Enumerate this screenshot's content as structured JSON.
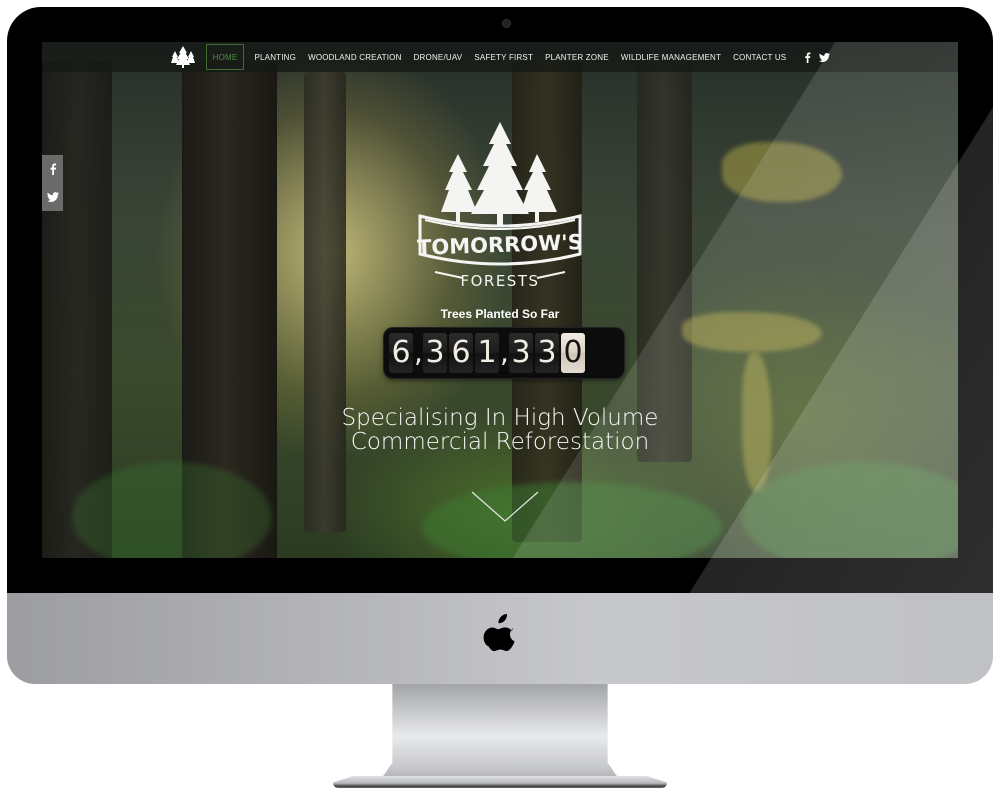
{
  "nav": {
    "items": [
      {
        "label": "HOME",
        "active": true
      },
      {
        "label": "PLANTING",
        "active": false
      },
      {
        "label": "WOODLAND CREATION",
        "active": false
      },
      {
        "label": "DRONE/UAV",
        "active": false
      },
      {
        "label": "SAFETY FIRST",
        "active": false
      },
      {
        "label": "PLANTER ZONE",
        "active": false
      },
      {
        "label": "WILDLIFE MANAGEMENT",
        "active": false
      },
      {
        "label": "CONTACT US",
        "active": false
      }
    ],
    "social": [
      "facebook-icon",
      "twitter-icon"
    ],
    "active_color": "#4e8a3f"
  },
  "side_social": [
    "facebook-icon",
    "twitter-icon"
  ],
  "logo": {
    "line1": "TOMORROW'S",
    "line2": "FORESTS"
  },
  "counter": {
    "label": "Trees Planted So Far",
    "value": "6,361,330",
    "digits": [
      "6",
      ",",
      "3",
      "6",
      "1",
      ",",
      "3",
      "3",
      "0"
    ]
  },
  "hero": {
    "tagline_line1": "Specialising In High Volume",
    "tagline_line2": "Commercial Reforestation"
  },
  "device": {
    "type": "iMac mockup",
    "logo": "apple-logo"
  }
}
